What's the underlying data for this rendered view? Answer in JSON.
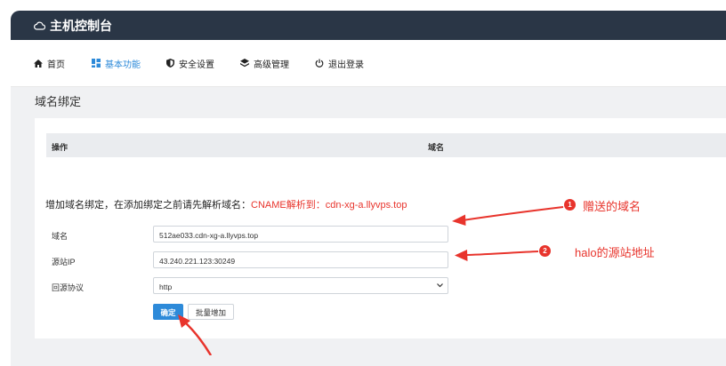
{
  "header": {
    "title": "主机控制台"
  },
  "nav": {
    "items": [
      {
        "label": "首页",
        "icon": "home-icon"
      },
      {
        "label": "基本功能",
        "icon": "grid-icon",
        "active": true
      },
      {
        "label": "安全设置",
        "icon": "shield-icon"
      },
      {
        "label": "高级管理",
        "icon": "layers-icon"
      },
      {
        "label": "退出登录",
        "icon": "power-icon"
      }
    ]
  },
  "page": {
    "title": "域名绑定"
  },
  "table": {
    "columns": [
      "操作",
      "域名"
    ]
  },
  "hint": {
    "text": "增加域名绑定，在添加绑定之前请先解析域名：",
    "highlight": "CNAME解析到：cdn-xg-a.llyvps.top"
  },
  "form": {
    "domain_label": "域名",
    "domain_value": "512ae033.cdn-xg-a.llyvps.top",
    "source_ip_label": "源站IP",
    "source_ip_value": "43.240.221.123:30249",
    "protocol_label": "回源协议",
    "protocol_value": "http",
    "confirm_label": "确定",
    "batch_add_label": "批量增加"
  },
  "annotations": [
    {
      "badge": "1",
      "text": "赠送的域名"
    },
    {
      "badge": "2",
      "text": "halo的源站地址"
    }
  ],
  "colors": {
    "topbar": "#2a3646",
    "accent": "#2d8ad9",
    "annotation": "#e8342c"
  }
}
